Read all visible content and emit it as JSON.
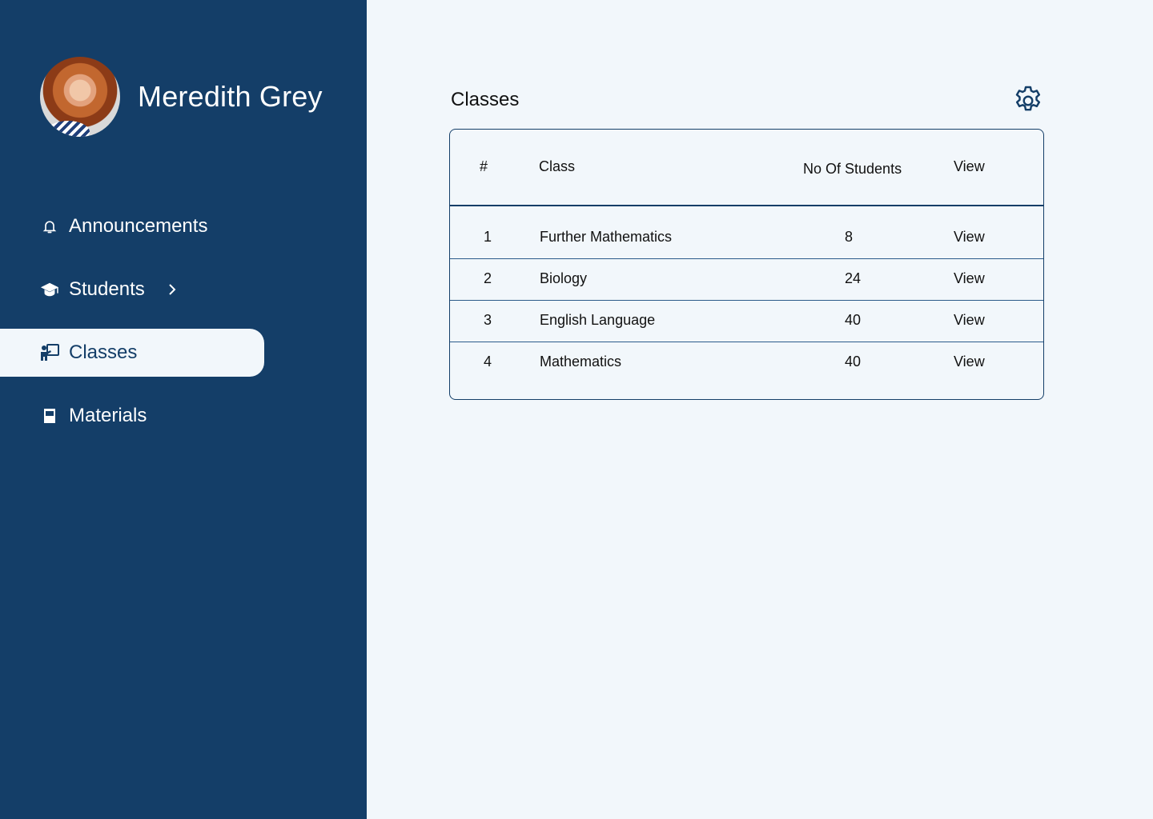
{
  "profile": {
    "name": "Meredith Grey"
  },
  "sidebar": {
    "items": [
      {
        "label": "Announcements",
        "icon": "bell-icon"
      },
      {
        "label": "Students",
        "icon": "graduation-cap-icon",
        "has_chevron": true
      },
      {
        "label": "Classes",
        "icon": "teacher-board-icon",
        "active": true
      },
      {
        "label": "Materials",
        "icon": "book-icon"
      }
    ]
  },
  "main": {
    "title": "Classes",
    "settings_icon": "gear-icon",
    "table": {
      "headers": [
        "#",
        "Class",
        "No Of Students",
        "View"
      ],
      "rows": [
        {
          "num": "1",
          "class": "Further Mathematics",
          "students": "8",
          "view": "View"
        },
        {
          "num": "2",
          "class": "Biology",
          "students": "24",
          "view": "View"
        },
        {
          "num": "3",
          "class": "English Language",
          "students": "40",
          "view": "View"
        },
        {
          "num": "4",
          "class": "Mathematics",
          "students": "40",
          "view": "View"
        }
      ]
    }
  },
  "colors": {
    "sidebar_bg": "#143e68",
    "page_bg": "#f2f7fb",
    "accent": "#143e68"
  }
}
